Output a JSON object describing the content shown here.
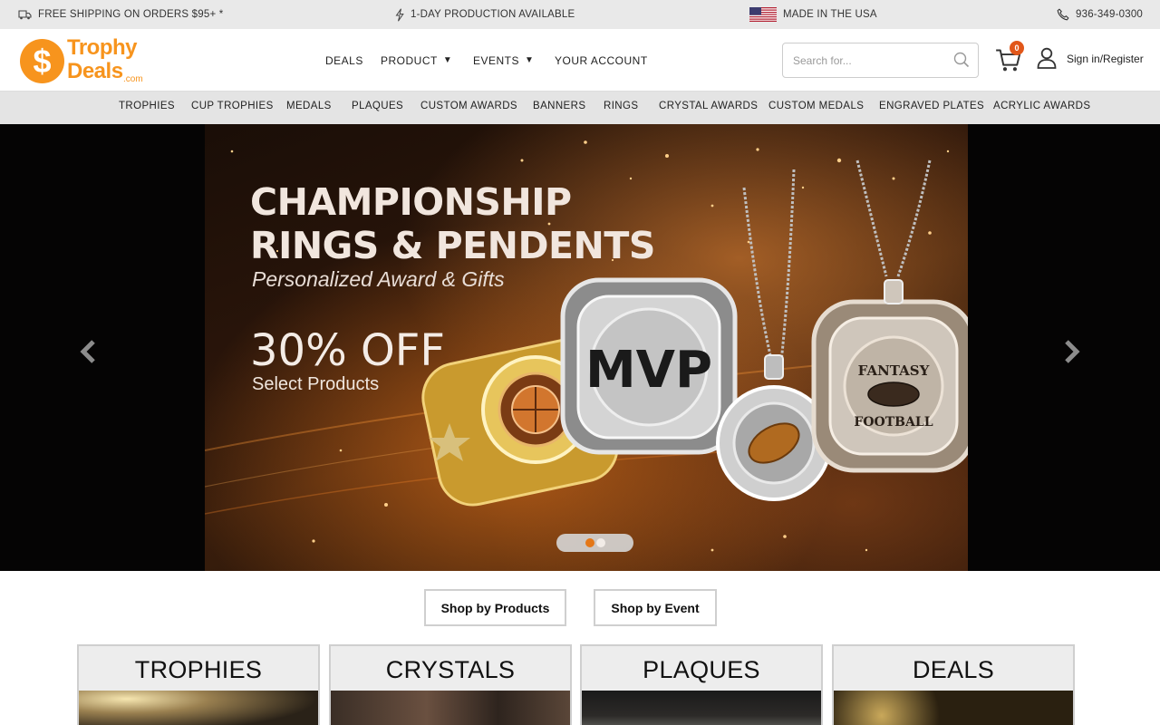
{
  "topbar": {
    "shipping": "FREE SHIPPING ON ORDERS $95+ *",
    "production": "1-DAY PRODUCTION AVAILABLE",
    "made": "MADE IN THE USA",
    "phone": "936-349-0300"
  },
  "logo": {
    "line1": "Trophy",
    "line2": "Deals",
    "suffix": ".com",
    "symbol": "$"
  },
  "nav": {
    "deals": "DEALS",
    "product": "PRODUCT",
    "events": "EVENTS",
    "account": "YOUR ACCOUNT",
    "caret": "▼"
  },
  "search": {
    "placeholder": "Search for..."
  },
  "cart": {
    "count": "0"
  },
  "account": {
    "signin": "Sign in/Register"
  },
  "categories": [
    "TROPHIES",
    "CUP TROPHIES",
    "MEDALS",
    "PLAQUES",
    "CUSTOM AWARDS",
    "BANNERS",
    "RINGS",
    "CRYSTAL AWARDS",
    "CUSTOM MEDALS",
    "ENGRAVED PLATES",
    "ACRYLIC AWARDS"
  ],
  "hero": {
    "title_line1": "CHAMPIONSHIP",
    "title_line2": "RINGS & PENDENTS",
    "subtitle": "Personalized Award & Gifts",
    "discount": "30% OFF",
    "note": "Select Products",
    "ring1_text": "MVP",
    "ring2_text_top": "FANTASY",
    "ring2_text_bottom": "FOOTBALL",
    "slide_count": 2,
    "active_slide": 1
  },
  "shop_by": {
    "products": "Shop by Products",
    "event": "Shop by Event"
  },
  "tiles": [
    "TROPHIES",
    "CRYSTALS",
    "PLAQUES",
    "DEALS"
  ],
  "colors": {
    "brand_orange": "#f7941d",
    "cart_badge": "#e1571a",
    "active_dot": "#f07d18"
  }
}
